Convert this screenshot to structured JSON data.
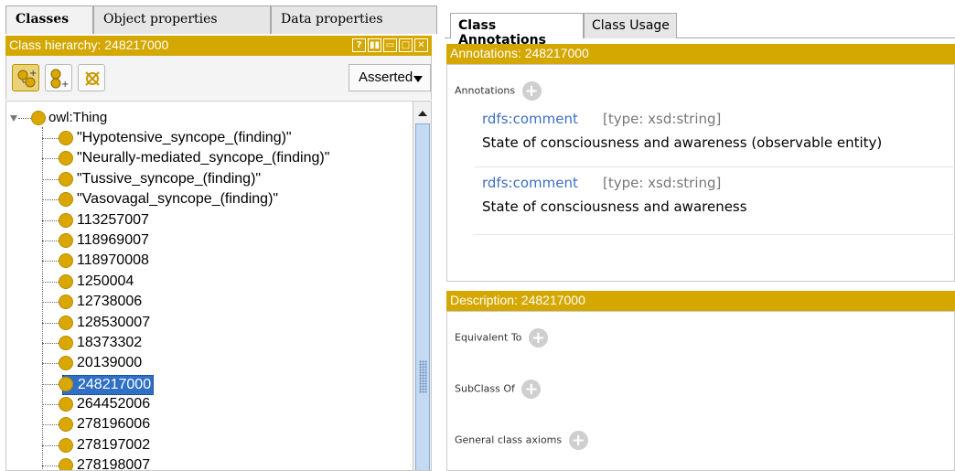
{
  "left_tabs": [
    "Classes",
    "Object properties",
    "Data properties"
  ],
  "class_hierarchy": {
    "header": "Class hierarchy: 248217000",
    "view_buttons": [
      "?",
      "▮▮",
      "▭",
      "□",
      "✕"
    ],
    "asserted_label": "Asserted",
    "root": "owl:Thing",
    "items": [
      "\"Hypotensive_syncope_(finding)\"",
      "\"Neurally-mediated_syncope_(finding)\"",
      "\"Tussive_syncope_(finding)\"",
      "\"Vasovagal_syncope_(finding)\"",
      "113257007",
      "118969007",
      "118970008",
      "1250004",
      "12738006",
      "128530007",
      "18373302",
      "20139000",
      "248217000",
      "264452006",
      "278196006",
      "278197002",
      "278198007"
    ],
    "selected": "248217000",
    "toolbar_icons": [
      "add-subclass-icon",
      "add-sibling-class-icon",
      "delete-class-icon"
    ]
  },
  "right_tabs": [
    "Class Annotations",
    "Class Usage"
  ],
  "annotations": {
    "header": "Annotations: 248217000",
    "section_label": "Annotations",
    "rows": [
      {
        "property": "rdfs:comment",
        "type": "[type: xsd:string]",
        "value": "State of consciousness and awareness (observable entity)"
      },
      {
        "property": "rdfs:comment",
        "type": "[type: xsd:string]",
        "value": "State of consciousness and awareness"
      }
    ]
  },
  "description": {
    "header": "Description: 248217000",
    "sections": [
      "Equivalent To",
      "SubClass Of",
      "General class axioms"
    ]
  },
  "colors": {
    "accent": "#d4a800",
    "selection": "#2f6fc6",
    "link": "#3d6fc0"
  }
}
